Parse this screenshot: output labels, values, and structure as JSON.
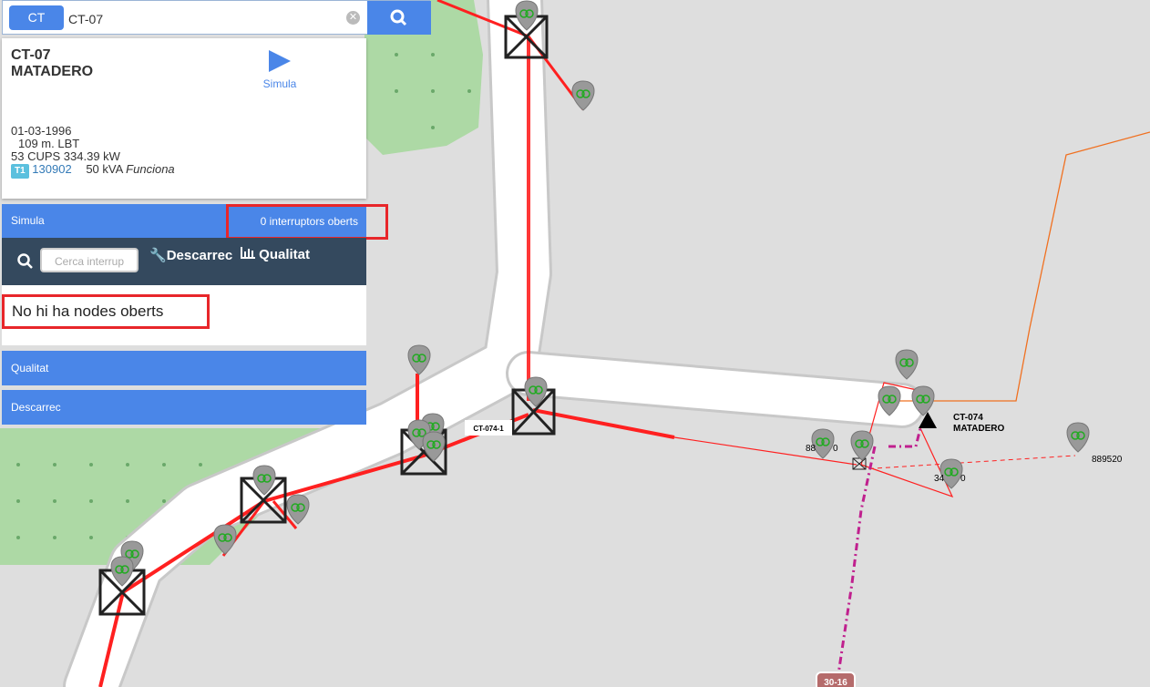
{
  "search": {
    "type_label": "CT",
    "value": "CT-07",
    "clear_icon": "clear-circle-icon",
    "button_icon": "search-icon"
  },
  "info": {
    "title_line1": "CT-07",
    "title_line2": "MATADERO",
    "simula_label": "Simula",
    "date": "01-03-1996",
    "length": "109 m. LBT",
    "cups": "53 CUPS 334.39   kW",
    "trafo_badge": "T1",
    "trafo_id": "130902",
    "trafo_power": "50 kVA",
    "trafo_status": "Funciona"
  },
  "simula_bar": {
    "label": "Simula",
    "interruptors": "0 interruptors oberts"
  },
  "toolbar": {
    "search_placeholder": "Cerca interrup",
    "descarrec": "Descarrec",
    "qualitat": "Qualitat"
  },
  "nodes": {
    "message": "No hi ha nodes oberts"
  },
  "sections": {
    "qualitat": "Qualitat",
    "descarrec": "Descarrec"
  },
  "map": {
    "label_ct074_1": "CT-074-1",
    "label_ct074": "CT-074",
    "label_matadero": "MATADERO",
    "label_889520": "889520",
    "label_88x": "88",
    "label_88x_b": "0",
    "label_34": "34",
    "label_34_b": "0",
    "label_3016": "30-16"
  },
  "colors": {
    "accent": "#4a86e8",
    "toolbar": "#34495e",
    "highlight": "#e8262a",
    "line": "#ff0000",
    "magenta": "#c0208e"
  }
}
